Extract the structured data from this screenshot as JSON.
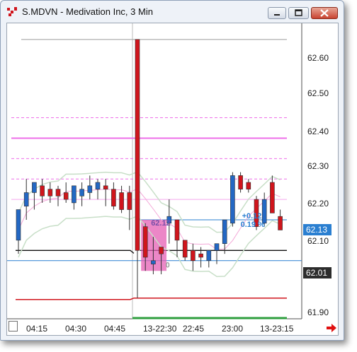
{
  "window": {
    "title": "S.MDVN - Medivation Inc, 3 Min",
    "buttons": [
      "minimize-button",
      "maximize-button",
      "close-button"
    ]
  },
  "colors": {
    "up_bar": "#2368c4",
    "down_bar": "#d0151c",
    "pink_lines": "#ee6fe9",
    "bollinger": "#c8dfc8",
    "last_price_tag": "#2a7fd1",
    "level_tag": "#2c2c2c",
    "highlight": "#e65fb4"
  },
  "chart_data": {
    "type": "candlestick",
    "ylim": [
      61.86,
      62.67
    ],
    "y_ticks": [
      "62.60",
      "62.50",
      "62.40",
      "62.30",
      "62.20",
      "62.10",
      "61.90"
    ],
    "x_ticks": [
      "04:15",
      "04:30",
      "04:45",
      "13-22:30",
      "22:45",
      "23:00",
      "13-23:15"
    ],
    "last_price_label": "62.13",
    "level_label": "62.01",
    "annotations": {
      "change": "+0.12",
      "change_pct": "0.19 %",
      "box_price": "62.12",
      "box_suffix": "0"
    },
    "candles": [
      {
        "o": 62.07,
        "h": 62.15,
        "l": 62.03,
        "c": 62.16
      },
      {
        "o": 62.17,
        "h": 62.25,
        "l": 62.13,
        "c": 62.21
      },
      {
        "o": 62.21,
        "h": 62.24,
        "l": 62.16,
        "c": 62.24
      },
      {
        "o": 62.23,
        "h": 62.25,
        "l": 62.18,
        "c": 62.2
      },
      {
        "o": 62.22,
        "h": 62.24,
        "l": 62.18,
        "c": 62.2
      },
      {
        "o": 62.22,
        "h": 62.23,
        "l": 62.17,
        "c": 62.2
      },
      {
        "o": 62.21,
        "h": 62.24,
        "l": 62.18,
        "c": 62.19
      },
      {
        "o": 62.18,
        "h": 62.22,
        "l": 62.16,
        "c": 62.23
      },
      {
        "o": 62.2,
        "h": 62.24,
        "l": 62.17,
        "c": 62.22
      },
      {
        "o": 62.21,
        "h": 62.26,
        "l": 62.19,
        "c": 62.23
      },
      {
        "o": 62.22,
        "h": 62.25,
        "l": 62.19,
        "c": 62.24
      },
      {
        "o": 62.23,
        "h": 62.25,
        "l": 62.17,
        "c": 62.22
      },
      {
        "o": 62.22,
        "h": 62.24,
        "l": 62.16,
        "c": 62.17
      },
      {
        "o": 62.21,
        "h": 62.23,
        "l": 62.15,
        "c": 62.16
      },
      {
        "o": 62.21,
        "h": 62.23,
        "l": 62.1,
        "c": 62.16
      },
      {
        "o": 62.66,
        "h": 62.66,
        "l": 61.9,
        "c": 62.04
      },
      {
        "o": 62.11,
        "h": 62.12,
        "l": 61.98,
        "c": 62.02
      },
      {
        "o": 62.0,
        "h": 62.08,
        "l": 61.97,
        "c": 62.01
      },
      {
        "o": 62.05,
        "h": 62.05,
        "l": 61.97,
        "c": 62.03
      },
      {
        "o": 62.12,
        "h": 62.19,
        "l": 62.06,
        "c": 62.14
      },
      {
        "o": 62.13,
        "h": 62.13,
        "l": 62.02,
        "c": 62.07
      },
      {
        "o": 62.07,
        "h": 62.07,
        "l": 62.01,
        "c": 62.02
      },
      {
        "o": 62.04,
        "h": 62.06,
        "l": 61.98,
        "c": 62.01
      },
      {
        "o": 62.03,
        "h": 62.05,
        "l": 61.99,
        "c": 62.02
      },
      {
        "o": 62.01,
        "h": 62.04,
        "l": 61.99,
        "c": 62.04
      },
      {
        "o": 62.04,
        "h": 62.06,
        "l": 62.0,
        "c": 62.06
      },
      {
        "o": 62.06,
        "h": 62.13,
        "l": 62.03,
        "c": 62.13
      },
      {
        "o": 62.12,
        "h": 62.27,
        "l": 62.11,
        "c": 62.26
      },
      {
        "o": 62.26,
        "h": 62.27,
        "l": 62.21,
        "c": 62.22
      },
      {
        "o": 62.24,
        "h": 62.25,
        "l": 62.21,
        "c": 62.22
      },
      {
        "o": 62.19,
        "h": 62.2,
        "l": 62.1,
        "c": 62.11
      },
      {
        "o": 62.12,
        "h": 62.21,
        "l": 62.11,
        "c": 62.19
      },
      {
        "o": 62.24,
        "h": 62.26,
        "l": 62.17,
        "c": 62.15
      },
      {
        "o": 62.14,
        "h": 62.16,
        "l": 62.1,
        "c": 62.1
      }
    ],
    "levels": {
      "top_grey": 62.66,
      "magenta_solid": 62.37,
      "magenta_dashed": [
        62.43,
        62.31,
        62.25
      ],
      "pink_solid": 62.19,
      "last_price": 62.13,
      "black_level": 62.04,
      "blue_level": 62.01,
      "red_bottom": 61.9
    }
  }
}
